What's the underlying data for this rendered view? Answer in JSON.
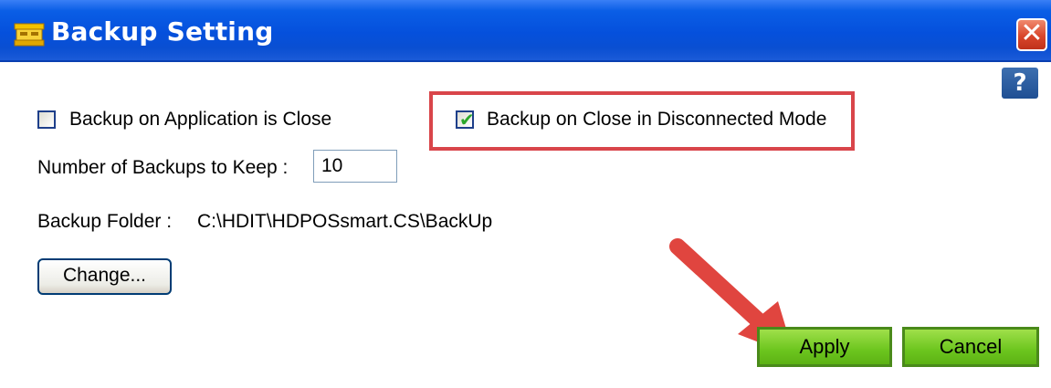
{
  "window": {
    "title": "Backup Setting",
    "close_symbol": "✕",
    "title_icon": "cash-register-icon"
  },
  "help": {
    "symbol": "?"
  },
  "options": {
    "backup_on_app_close": {
      "label": "Backup on Application is Close",
      "checked": false
    },
    "backup_on_close_disconnected": {
      "label": "Backup on Close in Disconnected Mode",
      "checked": true
    }
  },
  "num_backups": {
    "label": "Number of Backups  to Keep :",
    "value": "10"
  },
  "backup_folder": {
    "label": "Backup Folder :",
    "path": "C:\\HDIT\\HDPOSsmart.CS\\BackUp"
  },
  "buttons": {
    "change": "Change...",
    "apply": "Apply",
    "cancel": "Cancel"
  },
  "colors": {
    "titlebar": "#0550dc",
    "highlight": "#d9454a",
    "button_green": "#6cc51e",
    "arrow": "#e0453f"
  }
}
